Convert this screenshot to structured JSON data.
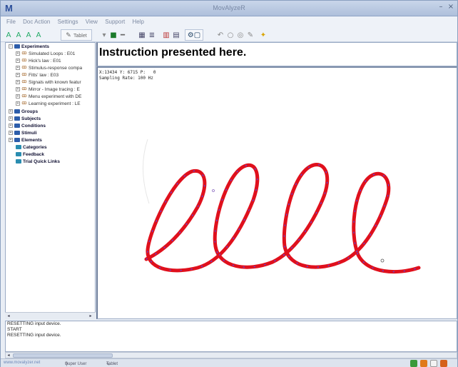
{
  "window": {
    "title": "MovAlyzeR"
  },
  "menu": {
    "items": [
      "File",
      "Doc Action",
      "Settings",
      "View",
      "Support",
      "Help"
    ]
  },
  "toolbar": {
    "tablet_label": "Tablet",
    "icons": [
      "fonts-icon",
      "tablet-icon",
      "record-icon",
      "stop-icon",
      "grid-icon",
      "chart-icon",
      "settings-icon",
      "shapes-icon",
      "help-icon"
    ]
  },
  "tree": {
    "experiments_label": "Experiments",
    "experiment_items": [
      "Simulated Loops : E01",
      "Hick's law : E01",
      "Stimulus-response compa",
      "Fitts' law : E03",
      "Signals with known featur",
      "Mirror - Image tracing : E",
      "Menu experiment with DE",
      "Learning experiment : LE"
    ],
    "groups_label": "Groups",
    "subjects_label": "Subjects",
    "conditions_label": "Conditions",
    "stimuli_label": "Stimuli",
    "elements_label": "Elements",
    "categories_label": "Categories",
    "feedback_label": "Feedback",
    "quick_links_label": "Trial Quick Links"
  },
  "instruction": {
    "text": "Instruction presented here."
  },
  "canvas": {
    "readout_line1": "X:13434 Y: 6715 P:   0",
    "readout_line2": "Sampling Rate: 100 Hz",
    "stroke_color": "#e0101c",
    "dot_color": "#6a3fd0"
  },
  "log": {
    "lines": [
      "RESETTING input device.",
      "START",
      "RESETTING input device."
    ]
  },
  "statusbar": {
    "website": "www.movalyzer.net",
    "tool1": "Super User",
    "tool2": "Tablet"
  },
  "colors": {
    "accent": "#2d5daa",
    "title_bg": "#aebfdb"
  }
}
